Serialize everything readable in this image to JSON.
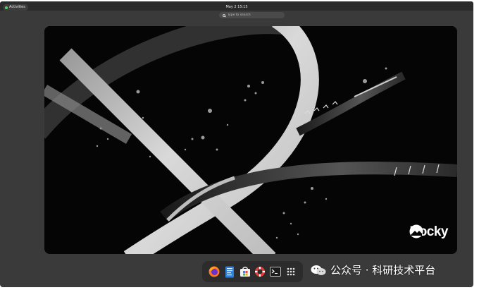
{
  "topbar": {
    "activities_label": "Activities",
    "clock": "May 2  15:15"
  },
  "search": {
    "placeholder": "Type to search"
  },
  "workspace": {
    "wallpaper": "Rocky Linux abstract wallpaper",
    "brand_text": "Rocky"
  },
  "dock": {
    "items": [
      {
        "name": "Firefox",
        "icon": "firefox-icon"
      },
      {
        "name": "Text Editor",
        "icon": "text-editor-icon"
      },
      {
        "name": "Software",
        "icon": "software-icon"
      },
      {
        "name": "Help",
        "icon": "help-icon"
      },
      {
        "name": "Terminal",
        "icon": "terminal-icon"
      },
      {
        "name": "Show Applications",
        "icon": "app-grid-icon"
      }
    ]
  },
  "watermark": {
    "text": "公众号 · 科研技术平台"
  },
  "colors": {
    "overview_bg": "#3a3a3a",
    "topbar_bg": "#2b2b2b",
    "dock_bg": "#2c2c2c",
    "accent_green": "#5ad06a"
  }
}
